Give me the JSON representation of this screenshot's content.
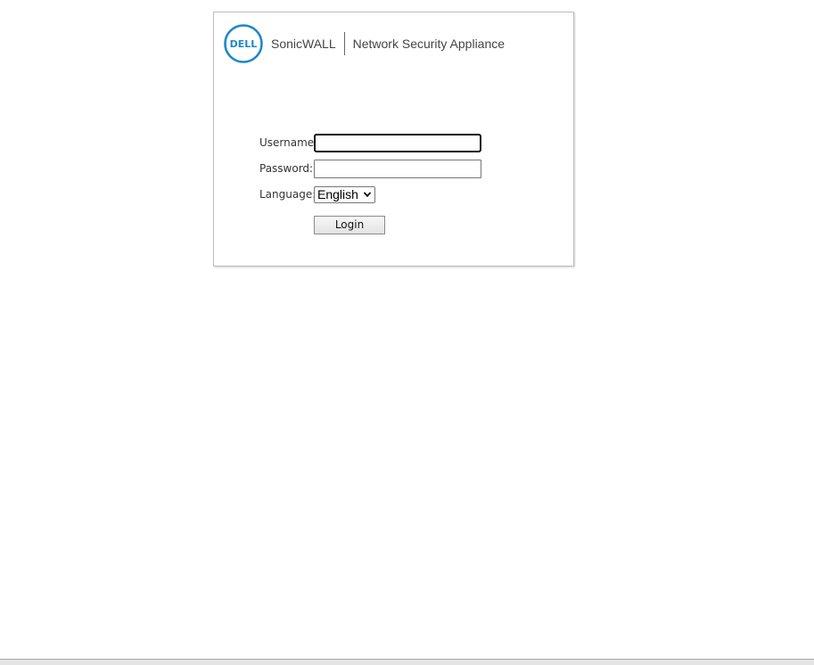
{
  "header": {
    "dell_logo_text": "DELL",
    "brand_name": "SonicWALL",
    "product_name": "Network Security Appliance"
  },
  "form": {
    "username_label": "Username:",
    "username_value": "",
    "password_label": "Password:",
    "password_value": "",
    "language_label": "Language:",
    "language_selected": "English",
    "login_label": "Login"
  },
  "colors": {
    "dell_blue": "#1e88c8",
    "text_gray": "#444444"
  },
  "icons": {
    "logo": "dell-logo-icon",
    "dropdown": "chevron-down-icon"
  }
}
